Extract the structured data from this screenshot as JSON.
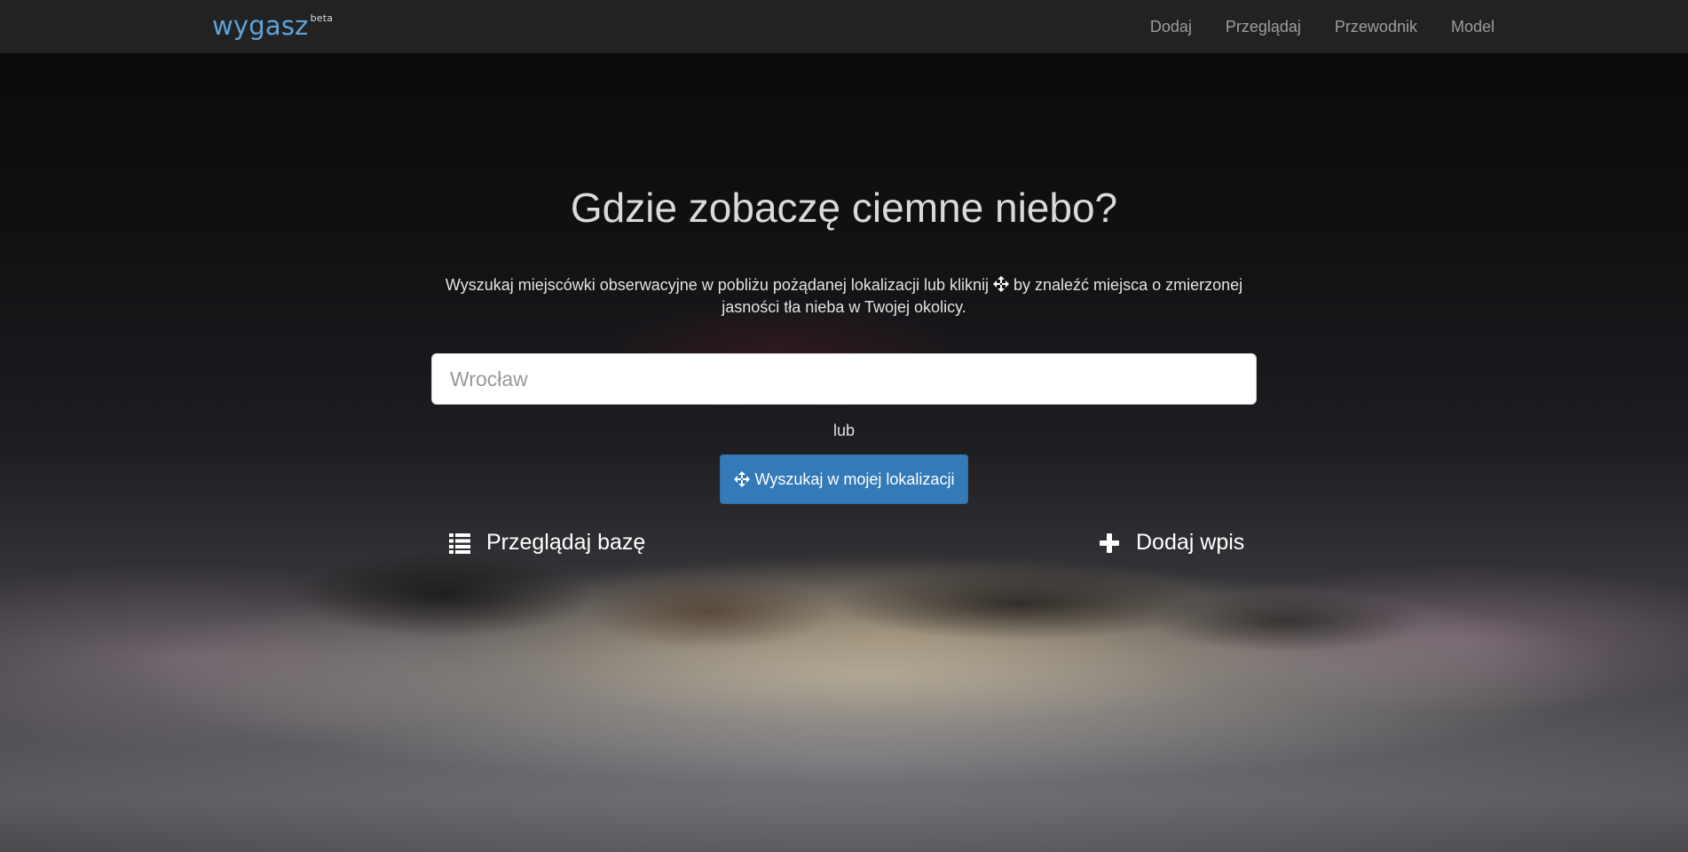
{
  "navbar": {
    "brand": "wygasz",
    "brand_badge": "beta",
    "links": [
      {
        "label": "Dodaj"
      },
      {
        "label": "Przeglądaj"
      },
      {
        "label": "Przewodnik"
      },
      {
        "label": "Model"
      }
    ]
  },
  "hero": {
    "title": "Gdzie zobaczę ciemne niebo?",
    "text_before_icon": "Wyszukaj miejscówki obserwacyjne w pobliżu pożądanej lokalizacji lub kliknij",
    "text_after_icon": "by znaleźć miejsca o zmierzonej jasności tła nieba w Twojej okolicy.",
    "icon": "move-arrows-icon"
  },
  "search": {
    "placeholder": "Wrocław",
    "value": ""
  },
  "or_text": "lub",
  "locate_button": {
    "label": "Wyszukaj w mojej lokalizacji",
    "icon": "move-arrows-icon",
    "color": "#337ab7"
  },
  "actions": {
    "browse": {
      "label": "Przeglądaj bazę",
      "icon": "list-icon"
    },
    "add": {
      "label": "Dodaj wpis",
      "icon": "plus-icon"
    }
  },
  "colors": {
    "brand": "#5fa3da",
    "navbar_bg": "#222222",
    "nav_link": "#9d9d9d"
  }
}
